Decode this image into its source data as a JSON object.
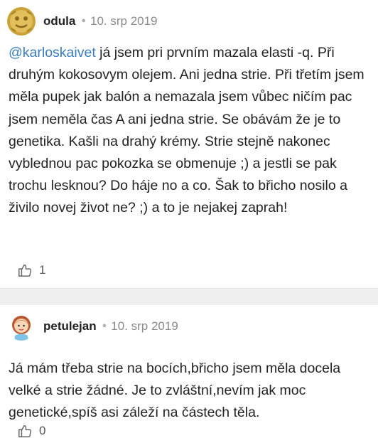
{
  "comments": [
    {
      "username": "odula",
      "date": "10. srp 2019",
      "mention": "@karloskaivet",
      "text": " já jsem pri prvním mazala elasti -q. Při druhým kokosovym olejem. Ani jedna strie. Při třetím jsem měla pupek jak balón a nemazala jsem vůbec ničím pac jsem neměla čas A ani jedna strie. Se obávám že je to genetika. Kašli na drahý krémy. Strie stejně nakonec vyblednou pac pokozka se obmenuje ;) a jestli se pak trochu lesknou? Do háje no a co. Šak to břicho nosilo a živilo novej život ne? ;) a to je nejakej zaprah!",
      "likes": "1",
      "avatar_icon": "gold-emblem-avatar-icon"
    },
    {
      "username": "petulejan",
      "date": "10. srp 2019",
      "text": "Já mám třeba strie na bocích,břicho jsem měla docela velké a strie žádné. Je to zvláštní,nevím jak moc genetické,spíš asi záleží na částech těla.",
      "likes": "0",
      "avatar_icon": "girl-avatar-icon"
    }
  ],
  "colors": {
    "mention": "#3b7dbf",
    "date": "#8a8a8a",
    "divider": "#f0f0f0"
  }
}
